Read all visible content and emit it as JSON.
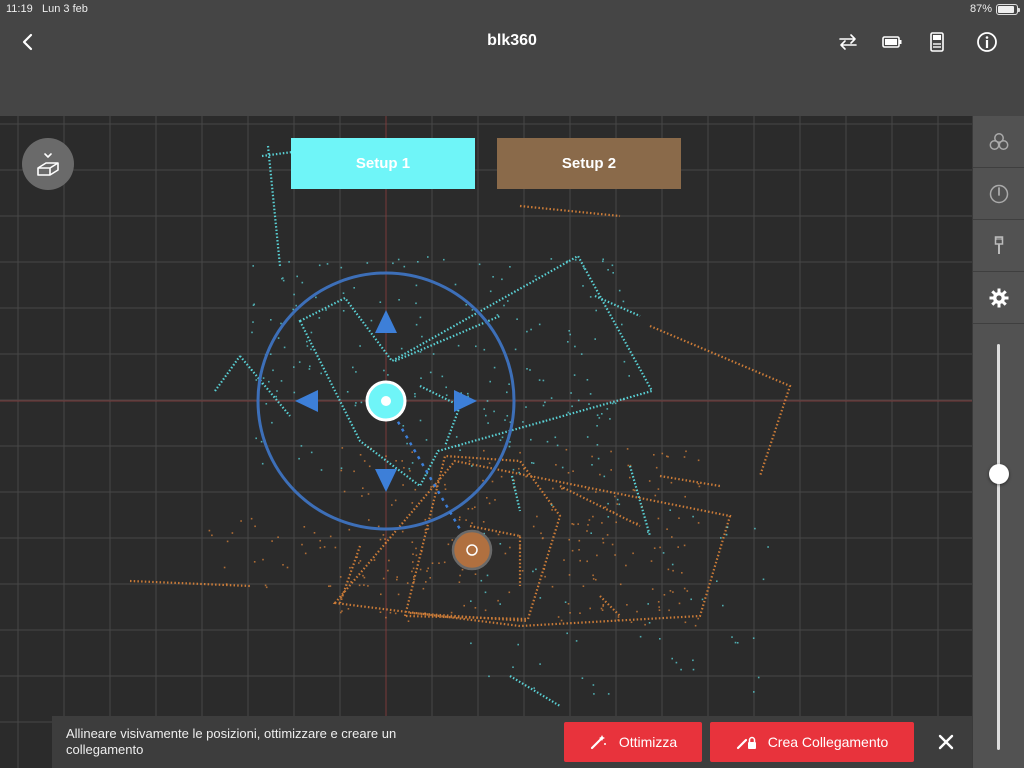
{
  "status_bar": {
    "time": "11:19",
    "date": "Lun 3 feb",
    "battery": "87%",
    "battery_level": 0.87
  },
  "nav": {
    "title": "blk360",
    "back_icon": "chevron-left-icon",
    "icons": [
      "swap-icon",
      "battery-icon",
      "scanner-icon",
      "info-icon"
    ]
  },
  "setups": {
    "setup1_label": "Setup 1",
    "setup2_label": "Setup 2",
    "setup1_color": "#6ff5f8",
    "setup2_color": "#8a6a4a"
  },
  "colors": {
    "cyan_points": "#5fe3e8",
    "orange_points": "#e88a3a",
    "control_ring": "#3d6fb8",
    "action_red": "#e8333c"
  },
  "side_panel": {
    "icons": [
      "layers-cluster-icon",
      "compass-icon",
      "brush-icon",
      "gear-icon"
    ],
    "slider_value": 0.68
  },
  "bottom_bar": {
    "message": "Allineare visivamente le posizioni, ottimizzare e creare un collegamento",
    "optimize_label": "Ottimizza",
    "link_label": "Crea Collegamento",
    "close_icon": "close-icon"
  }
}
